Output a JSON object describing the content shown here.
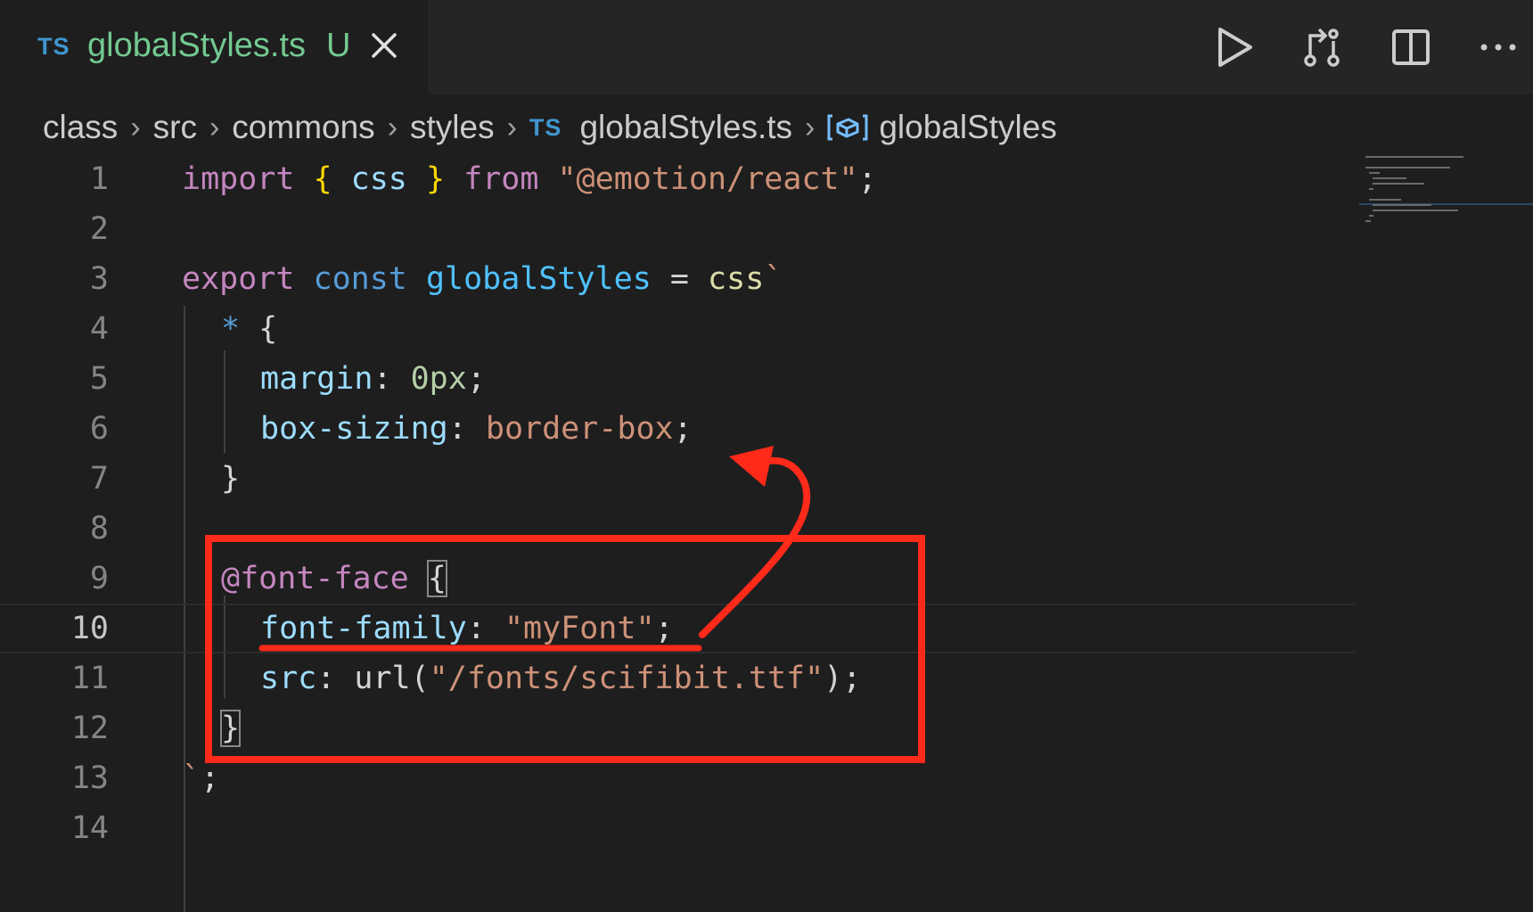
{
  "tab": {
    "lang_badge": "TS",
    "title": "globalStyles.ts",
    "status": "U"
  },
  "actions": [
    "run-icon",
    "compare-changes-icon",
    "split-editor-icon",
    "more-actions-icon"
  ],
  "breadcrumb": {
    "items": [
      "class",
      "src",
      "commons",
      "styles"
    ],
    "file_badge": "TS",
    "file": "globalStyles.ts",
    "symbol": "globalStyles"
  },
  "editor": {
    "current_line": 10,
    "line_numbers": [
      "1",
      "2",
      "3",
      "4",
      "5",
      "6",
      "7",
      "8",
      "9",
      "10",
      "11",
      "12",
      "13",
      "14"
    ]
  },
  "code": {
    "l1": {
      "import": "import",
      "lb": "{",
      "css": " css ",
      "rb": "}",
      "from": "from",
      "path": "\"@emotion/react\"",
      "semi": ";"
    },
    "l3": {
      "export": "export",
      "const": "const",
      "name": "globalStyles",
      "eq": " = ",
      "tag": "css",
      "tick": "`"
    },
    "l4": {
      "star": "*",
      "open": " {"
    },
    "l5": {
      "prop": "margin",
      "colon": ": ",
      "val": "0px",
      "semi": ";"
    },
    "l6": {
      "prop": "box-sizing",
      "colon": ": ",
      "val": "border-box",
      "semi": ";"
    },
    "l7": {
      "close": "}"
    },
    "l9": {
      "rule": "@font-face",
      "open": "{"
    },
    "l10": {
      "prop": "font-family",
      "colon": ": ",
      "val": "\"myFont\"",
      "semi": ";"
    },
    "l11": {
      "prop": "src",
      "colon": ": ",
      "fn": "url",
      "lp": "(",
      "val": "\"/fonts/scifibit.ttf\"",
      "rp": ")",
      "semi": ";"
    },
    "l12": {
      "close": "}"
    },
    "l13": {
      "tick": "`",
      "semi": ";"
    }
  },
  "colors": {
    "annotation": "#ff2a1a",
    "ts_badge": "#3f96d0",
    "untracked": "#73c991"
  }
}
